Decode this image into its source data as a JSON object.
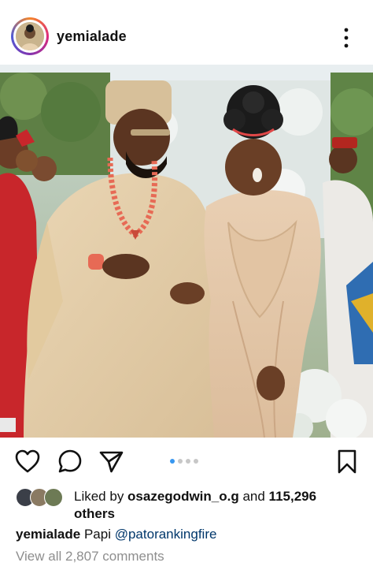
{
  "post": {
    "username": "yemialade",
    "more_icon": "more-vertical-icon"
  },
  "photo": {
    "carousel_count": 4,
    "carousel_active_index": 0
  },
  "actions": {
    "like_icon": "heart-icon",
    "comment_icon": "comment-icon",
    "share_icon": "send-icon",
    "save_icon": "bookmark-icon"
  },
  "likes": {
    "prefix": "Liked by ",
    "user": "osazegodwin_o.g",
    "middle": " and ",
    "count": "115,296",
    "suffix": " others"
  },
  "caption": {
    "username": "yemialade",
    "text": " Papi ",
    "mention": "@patorankingfire"
  },
  "comments": {
    "view_all": "View all 2,807 comments"
  },
  "colors": {
    "link_blue": "#3897f0",
    "mention": "#00376b",
    "muted": "#8e8e8e"
  }
}
